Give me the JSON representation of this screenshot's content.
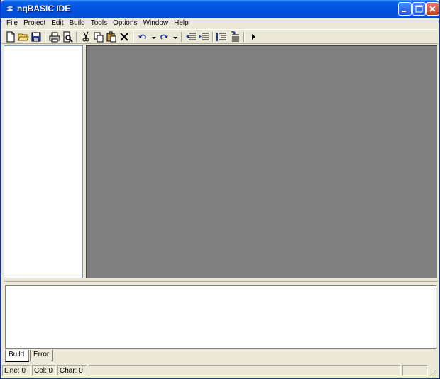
{
  "window": {
    "title": "nqBASIC IDE"
  },
  "menu": [
    "File",
    "Project",
    "Edit",
    "Build",
    "Tools",
    "Options",
    "Window",
    "Help"
  ],
  "toolbar": {
    "icons": [
      "new-file-icon",
      "open-folder-icon",
      "save-icon",
      "print-icon",
      "print-preview-icon",
      "cut-icon",
      "copy-icon",
      "paste-icon",
      "delete-icon",
      "undo-icon",
      "redo-icon",
      "outdent-icon",
      "indent-icon",
      "comment-icon",
      "uncomment-icon",
      "run-icon"
    ]
  },
  "tabs": [
    "Build",
    "Error"
  ],
  "status": {
    "line": "Line: 0",
    "col": "Col: 0",
    "char": "Char: 0"
  },
  "colors": {
    "titlebar": "#0053e1",
    "mdi_background": "#808080",
    "chrome": "#ece9d8"
  }
}
